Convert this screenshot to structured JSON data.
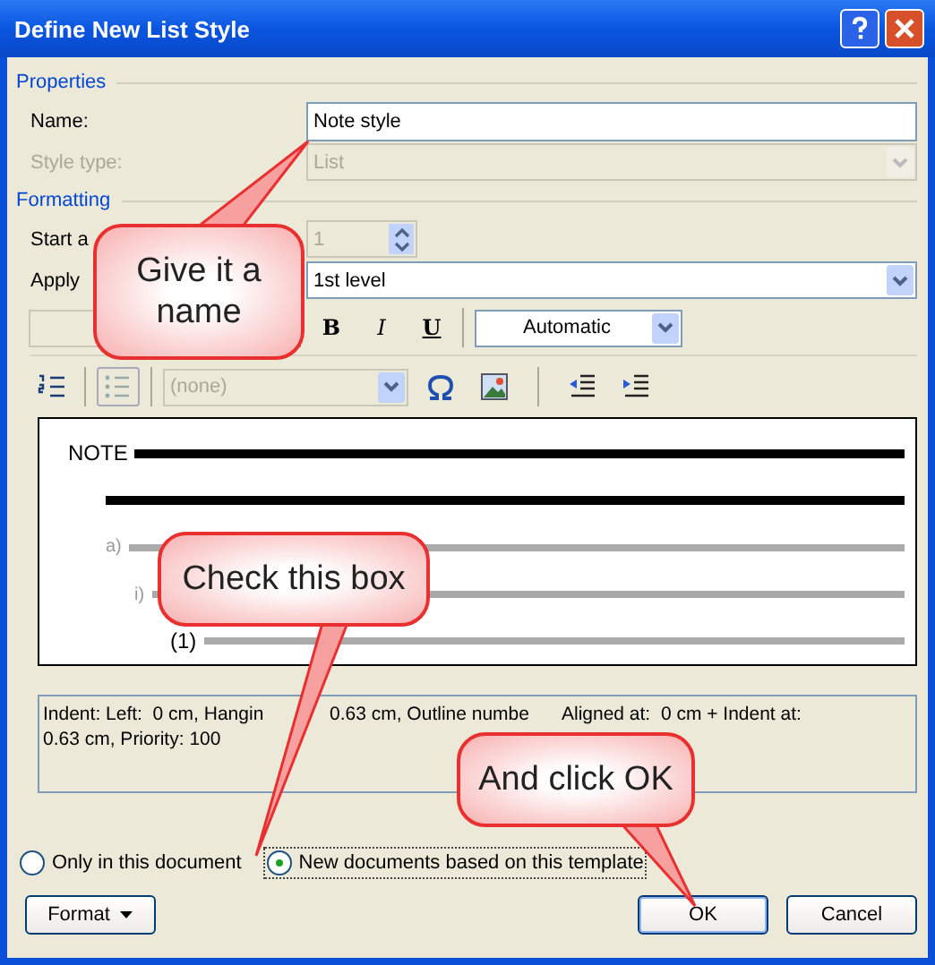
{
  "window": {
    "title": "Define New List Style"
  },
  "properties": {
    "heading": "Properties",
    "name": {
      "label": "Name:",
      "value": "Note style"
    },
    "style_type": {
      "label": "Style type:",
      "value": "List",
      "disabled": true
    }
  },
  "formatting": {
    "heading": "Formatting",
    "start_at": {
      "label": "Start a",
      "value": "1",
      "disabled": true
    },
    "apply_to": {
      "label": "Apply",
      "value": "1st level"
    },
    "font_bar": {
      "font": {
        "disabled": true
      },
      "styles": [
        {
          "label": "B",
          "kind": "bold"
        },
        {
          "label": "I",
          "kind": "italic"
        },
        {
          "label": "U",
          "kind": "underline"
        }
      ],
      "font_color_label": "Automatic"
    },
    "list_bar": {
      "symbol": {
        "value": "(none)",
        "disabled": true
      }
    }
  },
  "preview": {
    "lines": [
      {
        "label": "NOTE",
        "kind": "heading"
      },
      {
        "kind": "plain"
      },
      {
        "label": "a)",
        "kind": "level2"
      },
      {
        "label": "i)",
        "kind": "level3"
      },
      {
        "label": "(1)",
        "kind": "level4"
      }
    ]
  },
  "description": {
    "line_1_parts": [
      "Indent: Left:  0 cm, Hangin",
      "0.63 cm, Outline numbe",
      "Aligned at:  0 cm + Indent at:"
    ],
    "line_2": "0.63 cm, Priority: 100"
  },
  "scope": [
    {
      "label": "Only in this document",
      "selected": false
    },
    {
      "label": "New documents based on this template",
      "selected": true
    }
  ],
  "buttons": {
    "format": "Format",
    "ok": "OK",
    "cancel": "Cancel"
  },
  "callouts": [
    {
      "text": "Give it a name"
    },
    {
      "text": "Check this box"
    },
    {
      "text": "And click OK"
    }
  ]
}
